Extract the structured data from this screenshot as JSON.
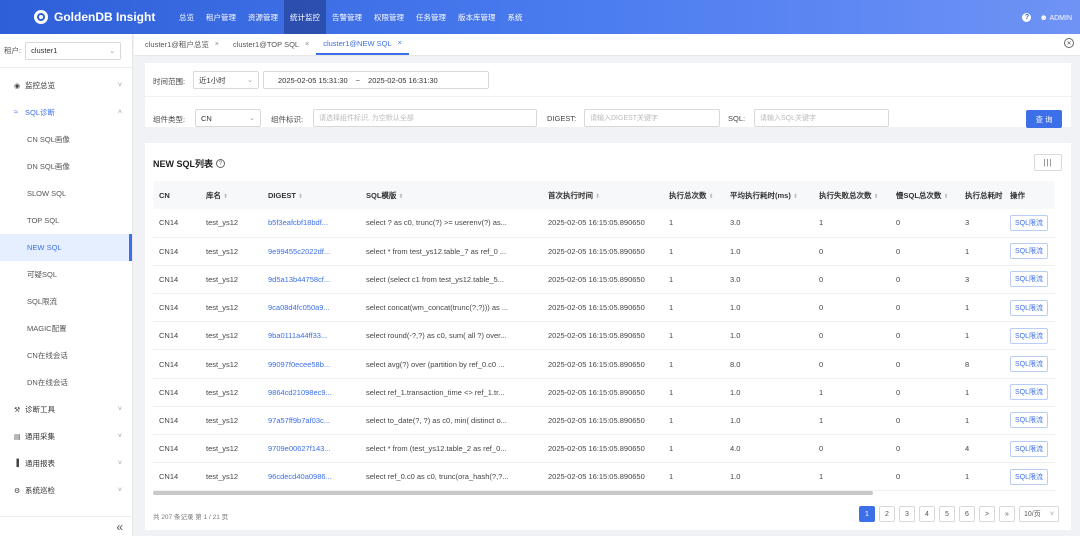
{
  "app": {
    "title": "GoldenDB Insight"
  },
  "topnav": {
    "items": [
      "总览",
      "租户管理",
      "资源管理",
      "统计监控",
      "告警管理",
      "权限管理",
      "任务管理",
      "版本库管理",
      "系统"
    ],
    "active_index": 3,
    "user": "ADMIN"
  },
  "sidebar": {
    "tenant_label": "租户:",
    "tenant_value": "cluster1",
    "groups": [
      {
        "label": "监控总览",
        "icon": "eye-icon",
        "open": false
      },
      {
        "label": "SQL诊断",
        "icon": "chart-icon",
        "open": true
      }
    ],
    "sub_items": [
      "CN SQL画像",
      "DN SQL画像",
      "SLOW SQL",
      "TOP SQL",
      "NEW SQL",
      "可疑SQL",
      "SQL限流",
      "MAGIC配置",
      "CN在线会话",
      "DN在线会话"
    ],
    "active_sub_index": 4,
    "bottom_groups": [
      {
        "label": "诊断工具",
        "icon": "tool-icon"
      },
      {
        "label": "通用采集",
        "icon": "collect-icon"
      },
      {
        "label": "通用报表",
        "icon": "bar-chart-icon"
      },
      {
        "label": "系统巡检",
        "icon": "inspect-icon"
      }
    ],
    "collapse_glyph": "«"
  },
  "tabs": [
    {
      "label": "cluster1@租户总览",
      "active": false
    },
    {
      "label": "cluster1@TOP SQL",
      "active": false
    },
    {
      "label": "cluster1@NEW SQL",
      "active": true
    }
  ],
  "filters": {
    "time_range_label": "时间范围:",
    "time_range_value": "近1小时",
    "start_time": "2025-02-05 15:31:30",
    "range_sep": "~",
    "end_time": "2025-02-05 16:31:30",
    "component_type_label": "组件类型:",
    "component_type_value": "CN",
    "component_id_label": "组件标识:",
    "component_id_placeholder": "请选择组件标识, 为空默认全部",
    "digest_label": "DIGEST:",
    "digest_placeholder": "请输入DIGEST关键字",
    "sql_label": "SQL:",
    "sql_placeholder": "请输入SQL关键字",
    "query_button": "查 询"
  },
  "list": {
    "title": "NEW SQL列表",
    "columns": [
      "CN",
      "库名",
      "DIGEST",
      "SQL模版",
      "首次执行时间",
      "执行总次数",
      "平均执行耗时(ms)",
      "执行失败总次数",
      "慢SQL总次数",
      "执行总耗时",
      "操作"
    ],
    "sortable": [
      false,
      true,
      true,
      true,
      true,
      true,
      true,
      true,
      true,
      false,
      false
    ],
    "rows": [
      {
        "cn": "CN14",
        "db": "test_ys12",
        "digest": "b5f3eafcbf18bdf...",
        "sql": "select ? as c0, trunc(?) >= userenv(?) as...",
        "first_time": "2025-02-05 16:15:05.890650",
        "exec_count": "1",
        "avg_ms": "3.0",
        "fail_count": "1",
        "slow_count": "0",
        "total": "3",
        "op": "SQL限流"
      },
      {
        "cn": "CN14",
        "db": "test_ys12",
        "digest": "9e99455c2022df...",
        "sql": "select * from test_ys12.table_7 as ref_0 ...",
        "first_time": "2025-02-05 16:15:05.890650",
        "exec_count": "1",
        "avg_ms": "1.0",
        "fail_count": "0",
        "slow_count": "0",
        "total": "1",
        "op": "SQL限流"
      },
      {
        "cn": "CN14",
        "db": "test_ys12",
        "digest": "9d5a13b44758cf...",
        "sql": "select (select c1 from test_ys12.table_5...",
        "first_time": "2025-02-05 16:15:05.890650",
        "exec_count": "1",
        "avg_ms": "3.0",
        "fail_count": "0",
        "slow_count": "0",
        "total": "3",
        "op": "SQL限流"
      },
      {
        "cn": "CN14",
        "db": "test_ys12",
        "digest": "9ca08d4fc050a9...",
        "sql": "select concat(wm_concat(trunc(?,?))) as ...",
        "first_time": "2025-02-05 16:15:05.890650",
        "exec_count": "1",
        "avg_ms": "1.0",
        "fail_count": "0",
        "slow_count": "0",
        "total": "1",
        "op": "SQL限流"
      },
      {
        "cn": "CN14",
        "db": "test_ys12",
        "digest": "9ba0111a44ff33...",
        "sql": "select round(-?,?) as c0, sum( all ?) over...",
        "first_time": "2025-02-05 16:15:05.890650",
        "exec_count": "1",
        "avg_ms": "1.0",
        "fail_count": "0",
        "slow_count": "0",
        "total": "1",
        "op": "SQL限流"
      },
      {
        "cn": "CN14",
        "db": "test_ys12",
        "digest": "99097f0ecee58b...",
        "sql": "select avg(?) over (partition by ref_0.c0 ...",
        "first_time": "2025-02-05 16:15:05.890650",
        "exec_count": "1",
        "avg_ms": "8.0",
        "fail_count": "0",
        "slow_count": "0",
        "total": "8",
        "op": "SQL限流"
      },
      {
        "cn": "CN14",
        "db": "test_ys12",
        "digest": "9864cd21098ec9...",
        "sql": "select ref_1.transaction_time <> ref_1.tr...",
        "first_time": "2025-02-05 16:15:05.890650",
        "exec_count": "1",
        "avg_ms": "1.0",
        "fail_count": "1",
        "slow_count": "0",
        "total": "1",
        "op": "SQL限流"
      },
      {
        "cn": "CN14",
        "db": "test_ys12",
        "digest": "97a57ff9b7af03c...",
        "sql": "select to_date(?, ?) as c0, min( distinct o...",
        "first_time": "2025-02-05 16:15:05.890650",
        "exec_count": "1",
        "avg_ms": "1.0",
        "fail_count": "1",
        "slow_count": "0",
        "total": "1",
        "op": "SQL限流"
      },
      {
        "cn": "CN14",
        "db": "test_ys12",
        "digest": "9709e00627f143...",
        "sql": "select * from (test_ys12.table_2 as ref_0...",
        "first_time": "2025-02-05 16:15:05.890650",
        "exec_count": "1",
        "avg_ms": "4.0",
        "fail_count": "0",
        "slow_count": "0",
        "total": "4",
        "op": "SQL限流"
      },
      {
        "cn": "CN14",
        "db": "test_ys12",
        "digest": "96cdecd40a0986...",
        "sql": "select ref_0.c0 as c0, trunc(ora_hash(?,?...",
        "first_time": "2025-02-05 16:15:05.890650",
        "exec_count": "1",
        "avg_ms": "1.0",
        "fail_count": "1",
        "slow_count": "0",
        "total": "1",
        "op": "SQL限流"
      }
    ],
    "footer_text": "共 207 条记录  第 1 / 21 页",
    "pages": [
      "1",
      "2",
      "3",
      "4",
      "5",
      "6"
    ],
    "active_page": "1",
    "next_glyph": ">",
    "last_glyph": "»",
    "page_size": "10/页"
  },
  "colors": {
    "accent": "#3c6fe8",
    "topbar": "#2f5fd8"
  }
}
